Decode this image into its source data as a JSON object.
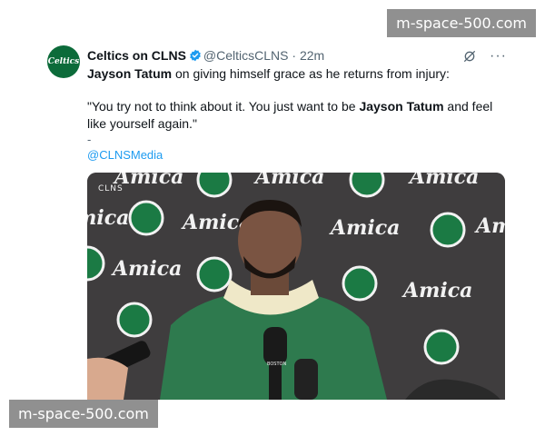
{
  "tweet": {
    "avatar_text": "Celtics",
    "display_name": "Celtics on CLNS",
    "handle": "@CelticsCLNS",
    "separator": "·",
    "time": "22m",
    "line_bold": "Jayson Tatum",
    "line_rest": " on giving himself grace as he returns from injury:",
    "quote_part1": "\"You try not to think about it. You just want to be ",
    "quote_bold": "Jayson Tatum",
    "quote_part2": " and feel like yourself again.\"",
    "dash": "-",
    "mention": "@CLNSMedia",
    "more_icon": "···"
  },
  "media": {
    "backdrop_words": [
      "Amica"
    ],
    "corner_logo": "CLNS",
    "mic_label": "BOSTON"
  },
  "watermarks": {
    "top": "m-space-500.com",
    "bottom": "m-space-500.com"
  },
  "colors": {
    "link": "#1d9bf0",
    "verified": "#1d9bf0",
    "celtics_green": "#0c6b3a",
    "hoodie_green": "#2e7a4e"
  }
}
